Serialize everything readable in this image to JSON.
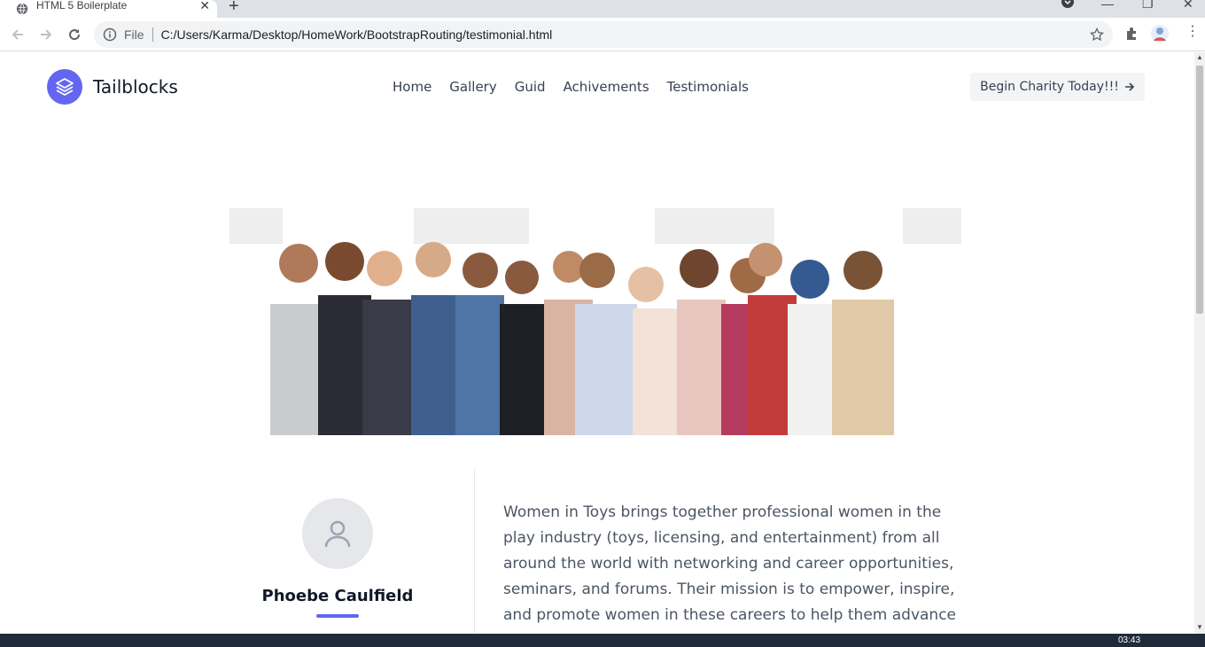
{
  "browser": {
    "tab_title": "HTML 5 Boilerplate",
    "address_scheme": "File",
    "address_url": "C:/Users/Karma/Desktop/HomeWork/BootstrapRouting/testimonial.html"
  },
  "site": {
    "brand": "Tailblocks",
    "nav": [
      "Home",
      "Gallery",
      "Guid",
      "Achivements",
      "Testimonials"
    ],
    "cta_label": "Begin Charity Today!!!",
    "accent_color": "#6366f1"
  },
  "testimonial": {
    "name": "Phoebe Caulfield",
    "bio": "Women in Toys brings together professional women in the play industry (toys, licensing, and entertainment) from all around the world with networking and career opportunities, seminars, and forums. Their mission is to empower, inspire, and promote women in these careers to help them advance in the industry"
  },
  "taskbar": {
    "clock": "03:43"
  }
}
